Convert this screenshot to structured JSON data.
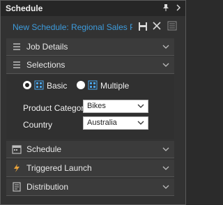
{
  "titlebar": {
    "title": "Schedule"
  },
  "schedule": {
    "name": "New Schedule: Regional Sales Publicat..."
  },
  "sections": {
    "job_details": "Job Details",
    "selections": "Selections",
    "schedule": "Schedule",
    "triggered_launch": "Triggered Launch",
    "distribution": "Distribution"
  },
  "selection_mode": {
    "basic_label": "Basic",
    "multiple_label": "Multiple",
    "selected": "Basic"
  },
  "fields": {
    "product_category": {
      "label": "Product Category",
      "value": "Bikes"
    },
    "country": {
      "label": "Country",
      "value": "Australia"
    }
  },
  "colors": {
    "accent": "#3d9bdc",
    "lightning": "#e8a23a"
  }
}
